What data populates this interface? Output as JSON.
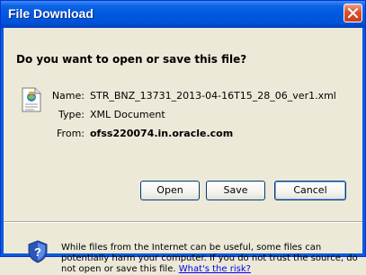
{
  "window": {
    "title": "File Download"
  },
  "dialog": {
    "question": "Do you want to open or save this file?",
    "file": {
      "name_label": "Name:",
      "name": "STR_BNZ_13731_2013-04-16T15_28_06_ver1.xml",
      "type_label": "Type:",
      "type": "XML Document",
      "from_label": "From:",
      "from": "ofss220074.in.oracle.com"
    },
    "buttons": {
      "open": "Open",
      "save": "Save",
      "cancel": "Cancel"
    },
    "warning": {
      "text": "While files from the Internet can be useful, some files can potentially harm your computer. If you do not trust the source, do not open or save this file.",
      "link": "What's the risk?"
    }
  },
  "colors": {
    "titlebar": "#0054e3",
    "close": "#d9542c",
    "dialog_bg": "#ece9d8",
    "link": "#0000ee"
  },
  "icons": [
    "close-icon",
    "xml-file-icon",
    "shield-warning-icon"
  ]
}
